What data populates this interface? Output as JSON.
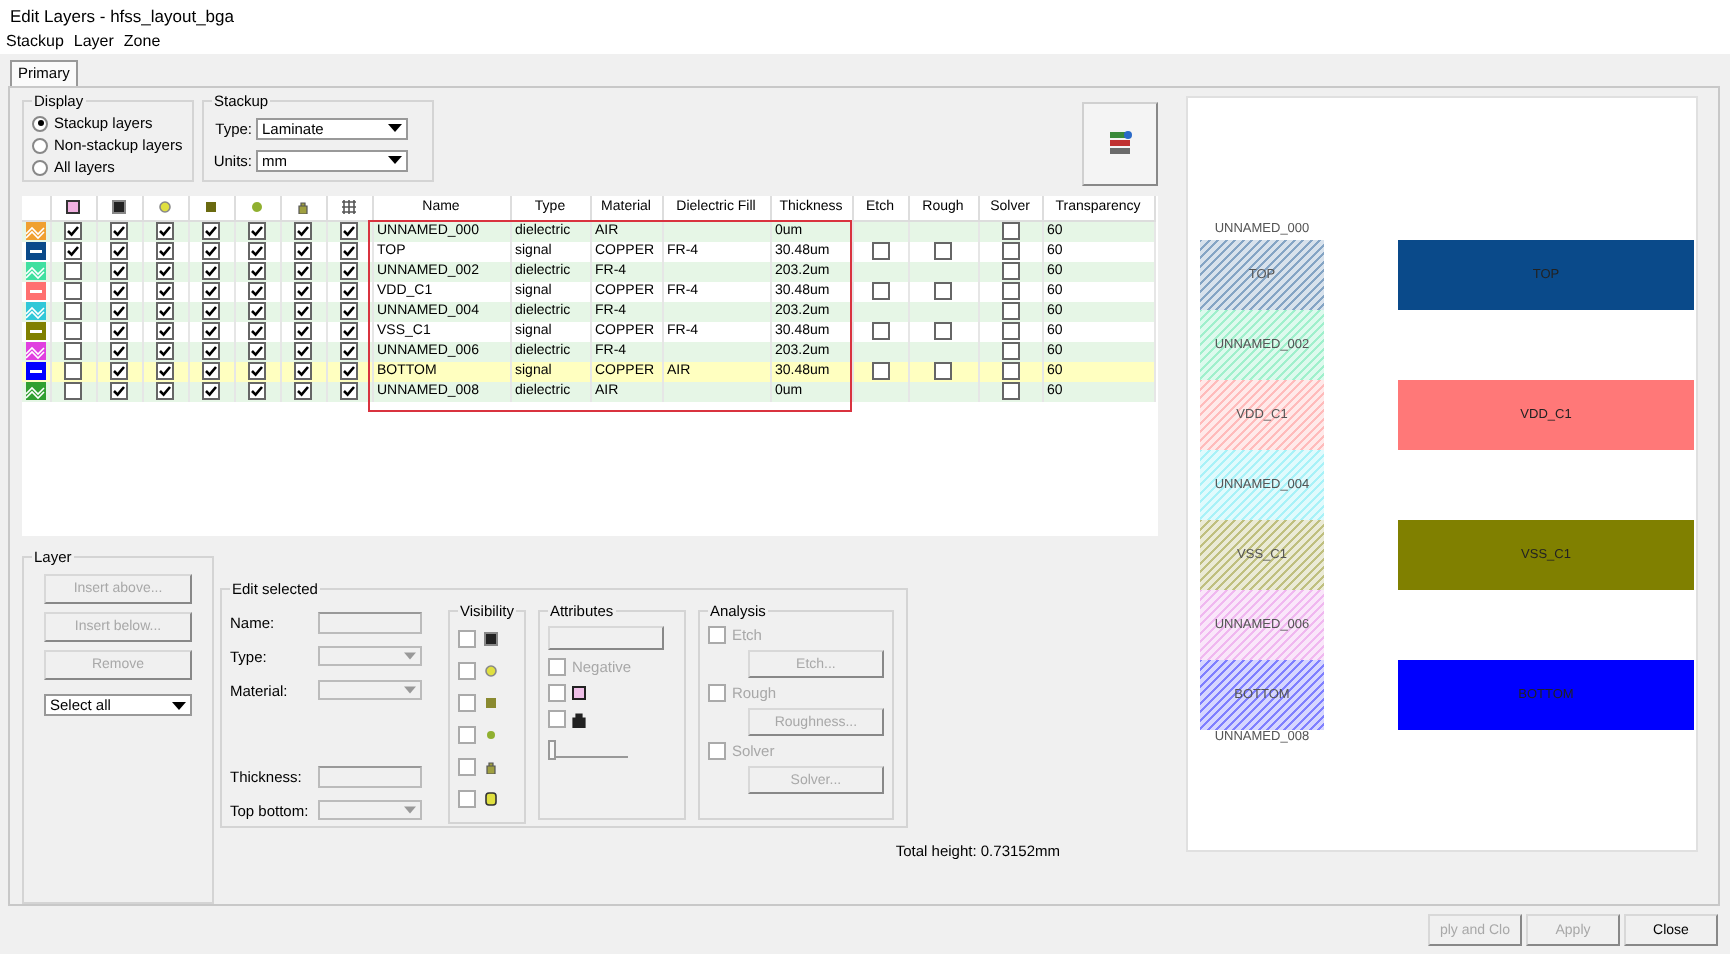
{
  "window": {
    "title": "Edit Layers - hfss_layout_bga"
  },
  "menu": [
    "Stackup",
    "Layer",
    "Zone"
  ],
  "tabs": [
    {
      "label": "Primary",
      "selected": true
    }
  ],
  "display": {
    "title": "Display",
    "options": [
      {
        "label": "Stackup layers",
        "selected": true
      },
      {
        "label": "Non-stackup layers",
        "selected": false
      },
      {
        "label": "All layers",
        "selected": false
      }
    ]
  },
  "stackup": {
    "title": "Stackup",
    "fields": [
      {
        "label": "Type:",
        "value": "Laminate"
      },
      {
        "label": "Units:",
        "value": "mm"
      }
    ]
  },
  "table": {
    "columns": [
      "Name",
      "Type",
      "Material",
      "Dielectric Fill",
      "Thickness",
      "Etch",
      "Rough",
      "Solver",
      "Transparency"
    ],
    "annotation_box": true,
    "rows": [
      {
        "kind": "dielectric",
        "color": "#f0a030",
        "visible": [
          true,
          true,
          true,
          true,
          true,
          true,
          true
        ],
        "name": "UNNAMED_000",
        "type": "dielectric",
        "material": "AIR",
        "thickness": "0um",
        "solver": false,
        "transparency": "60",
        "selected": false
      },
      {
        "kind": "signal",
        "color": "#0a4a8a",
        "visible": [
          true,
          true,
          true,
          true,
          true,
          true,
          true
        ],
        "name": "TOP",
        "type": "signal",
        "material": "COPPER",
        "fill": "FR-4",
        "thickness": "30.48um",
        "etch": false,
        "rough": false,
        "solver": false,
        "transparency": "60",
        "selected": false
      },
      {
        "kind": "dielectric",
        "color": "#40e0a0",
        "visible": [
          false,
          true,
          true,
          true,
          true,
          true,
          true
        ],
        "name": "UNNAMED_002",
        "type": "dielectric",
        "material": "FR-4",
        "thickness": "203.2um",
        "solver": false,
        "transparency": "60",
        "selected": false
      },
      {
        "kind": "signal",
        "color": "#ff7070",
        "visible": [
          false,
          true,
          true,
          true,
          true,
          true,
          true
        ],
        "name": "VDD_C1",
        "type": "signal",
        "material": "COPPER",
        "fill": "FR-4",
        "thickness": "30.48um",
        "etch": false,
        "rough": false,
        "solver": false,
        "transparency": "60",
        "selected": false
      },
      {
        "kind": "dielectric",
        "color": "#30c8d8",
        "visible": [
          false,
          true,
          true,
          true,
          true,
          true,
          true
        ],
        "name": "UNNAMED_004",
        "type": "dielectric",
        "material": "FR-4",
        "thickness": "203.2um",
        "solver": false,
        "transparency": "60",
        "selected": false
      },
      {
        "kind": "signal",
        "color": "#808000",
        "visible": [
          false,
          true,
          true,
          true,
          true,
          true,
          true
        ],
        "name": "VSS_C1",
        "type": "signal",
        "material": "COPPER",
        "fill": "FR-4",
        "thickness": "30.48um",
        "etch": false,
        "rough": false,
        "solver": false,
        "transparency": "60",
        "selected": false
      },
      {
        "kind": "dielectric",
        "color": "#e040e0",
        "visible": [
          false,
          true,
          true,
          true,
          true,
          true,
          true
        ],
        "name": "UNNAMED_006",
        "type": "dielectric",
        "material": "FR-4",
        "thickness": "203.2um",
        "solver": false,
        "transparency": "60",
        "selected": false
      },
      {
        "kind": "signal",
        "color": "#0000ff",
        "visible": [
          false,
          true,
          true,
          true,
          true,
          true,
          true
        ],
        "name": "BOTTOM",
        "type": "signal",
        "material": "COPPER",
        "fill": "AIR",
        "thickness": "30.48um",
        "etch": false,
        "rough": false,
        "solver": false,
        "transparency": "60",
        "selected": true
      },
      {
        "kind": "dielectric",
        "color": "#30a030",
        "visible": [
          false,
          true,
          true,
          true,
          true,
          true,
          true
        ],
        "name": "UNNAMED_008",
        "type": "dielectric",
        "material": "AIR",
        "thickness": "0um",
        "solver": false,
        "transparency": "60",
        "selected": false
      }
    ]
  },
  "layer_panel": {
    "title": "Layer",
    "buttons": [
      {
        "label": "Insert above...",
        "disabled": true
      },
      {
        "label": "Insert below...",
        "disabled": true
      },
      {
        "label": "Remove",
        "disabled": true
      }
    ],
    "select": "Select all"
  },
  "edit": {
    "title": "Edit selected",
    "fields": [
      {
        "label": "Name:",
        "kind": "text"
      },
      {
        "label": "Type:",
        "kind": "select"
      },
      {
        "label": "Material:",
        "kind": "select"
      },
      {
        "label": "Thickness:",
        "kind": "text"
      },
      {
        "label": "Top bottom:",
        "kind": "select"
      }
    ],
    "visibility": {
      "title": "Visibility",
      "items": [
        {
          "checked": false
        },
        {
          "checked": false
        },
        {
          "checked": false
        },
        {
          "checked": false
        },
        {
          "checked": false
        },
        {
          "checked": false
        }
      ]
    },
    "attributes": {
      "title": "Attributes",
      "negative": {
        "label": "Negative",
        "checked": false
      },
      "items": [
        {
          "checked": false
        },
        {
          "checked": false
        }
      ],
      "level": 0
    },
    "analysis": {
      "title": "Analysis",
      "items": [
        {
          "label": "Etch",
          "button": "Etch...",
          "checked": false
        },
        {
          "label": "Rough",
          "button": "Roughness...",
          "checked": false
        },
        {
          "label": "Solver",
          "button": "Solver...",
          "checked": false
        }
      ]
    }
  },
  "total": "Total height: 0.73152mm",
  "preview": {
    "layers": [
      {
        "kind": "thin",
        "label": "UNNAMED_000"
      },
      {
        "kind": "signal",
        "color": "#0a4a8a",
        "label": "TOP",
        "bar_label": "TOP"
      },
      {
        "kind": "dielectric",
        "color": "#a0f0cc",
        "label": "UNNAMED_002"
      },
      {
        "kind": "signal",
        "color": "#ff7878",
        "label": "VDD_C1",
        "bar_label": "VDD_C1"
      },
      {
        "kind": "dielectric",
        "color": "#a8f2f8",
        "label": "UNNAMED_004"
      },
      {
        "kind": "signal",
        "color": "#808000",
        "label": "VSS_C1",
        "bar_label": "VSS_C1"
      },
      {
        "kind": "dielectric",
        "color": "#f0b8f0",
        "label": "UNNAMED_006"
      },
      {
        "kind": "signal",
        "color": "#0000ff",
        "label": "BOTTOM",
        "bar_label": "BOTTOM"
      },
      {
        "kind": "thin",
        "label": "UNNAMED_008"
      }
    ]
  },
  "buttons": [
    {
      "label": "ply and Clo",
      "disabled": true
    },
    {
      "label": "Apply",
      "disabled": true
    },
    {
      "label": "Close",
      "disabled": false
    }
  ]
}
